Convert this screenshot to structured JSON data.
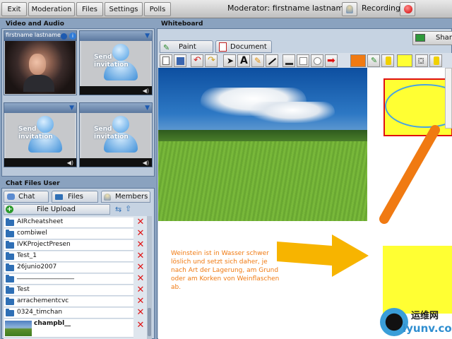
{
  "menu": {
    "items": [
      "Exit",
      "Moderation",
      "Files",
      "Settings",
      "Polls"
    ],
    "moderator": "Moderator: firstname lastname",
    "recording": "Recording:"
  },
  "video": {
    "title": "Video and Audio",
    "self_name": "firstname lastname",
    "invite_line1": "Send",
    "invite_line2": "invitation"
  },
  "chat": {
    "title": "Chat Files User",
    "tabs": [
      "Chat",
      "Files",
      "Members"
    ],
    "upload_label": "File Upload",
    "files": [
      "AIRcheatsheet",
      "combiwel",
      "IVKProjectPresen",
      "Test_1",
      "26junio2007",
      "__________________",
      "Test",
      "arrachementcvc",
      "0324_timchan",
      "champbl__"
    ]
  },
  "whiteboard": {
    "title": "Whiteboard",
    "tab_paint": "Paint",
    "tab_document": "Document",
    "share_label": "Shar",
    "annotation": "Weinstein ist in Wasser schwer löslich und setzt sich daher, je nach Art der Lagerung, am Grund oder am Korken von Weinflaschen ab.",
    "colors": {
      "stroke": "#f07a12",
      "fill": "#ffff33",
      "ellipse": "#4aa3e0",
      "arrow": "#f7b400"
    }
  },
  "watermark": {
    "text": "运维网",
    "url": "iyunv.com"
  }
}
